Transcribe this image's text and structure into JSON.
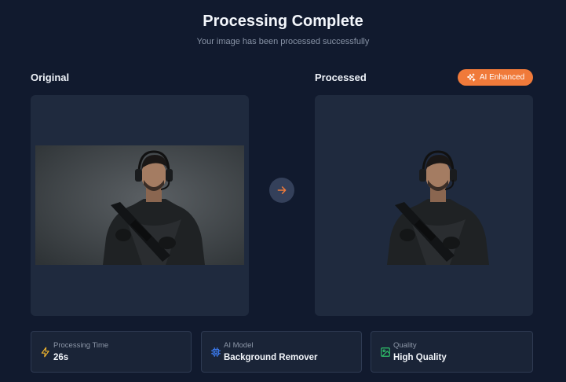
{
  "header": {
    "title": "Processing Complete",
    "subtitle": "Your image has been processed successfully"
  },
  "original": {
    "label": "Original"
  },
  "processed": {
    "label": "Processed",
    "badge": "AI Enhanced"
  },
  "stats": [
    {
      "label": "Processing Time",
      "value": "26s",
      "icon": "lightning-icon",
      "color": "#f5b82e"
    },
    {
      "label": "AI Model",
      "value": "Background Remover",
      "icon": "chip-icon",
      "color": "#3b7bf0"
    },
    {
      "label": "Quality",
      "value": "High Quality",
      "icon": "image-icon",
      "color": "#2fc26a"
    }
  ],
  "colors": {
    "accent": "#f07a3a",
    "background": "#111a2e",
    "panel": "#1f2a3e"
  }
}
